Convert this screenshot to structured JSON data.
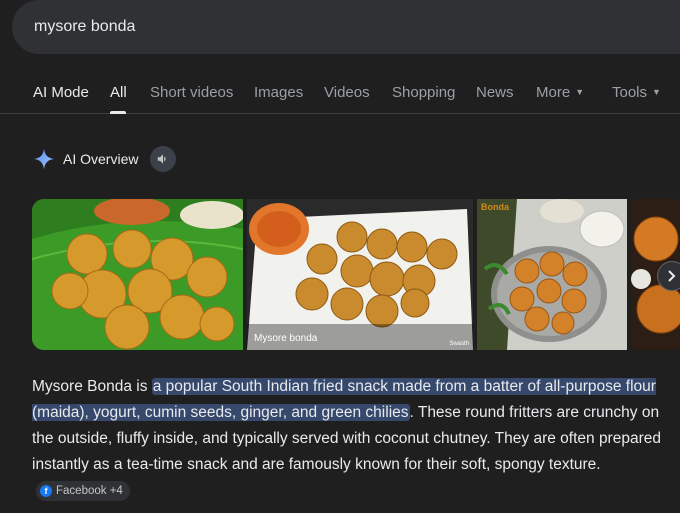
{
  "search": {
    "query": "mysore bonda"
  },
  "tabs": [
    {
      "label": "AI Mode"
    },
    {
      "label": "All"
    },
    {
      "label": "Short videos"
    },
    {
      "label": "Images"
    },
    {
      "label": "Videos"
    },
    {
      "label": "Shopping"
    },
    {
      "label": "News"
    },
    {
      "label": "More"
    },
    {
      "label": "Tools"
    }
  ],
  "active_tab": "All",
  "ai_overview": {
    "title": "AI Overview",
    "images": [
      {
        "icon": "food-photo"
      },
      {
        "caption": "Mysore bonda",
        "credit": "Swasth"
      },
      {
        "brand": "Bonda"
      },
      {
        "icon": "food-photo"
      }
    ],
    "paragraph": {
      "before": "Mysore Bonda is ",
      "highlight": "a popular South Indian fried snack made from a batter of all-purpose flour (maida), yogurt, cumin seeds, ginger, and green chilies",
      "after": ". These round fritters are crunchy on the outside, fluffy inside, and typically served with coconut chutney. They are often prepared instantly as a tea-time snack and are famously known for their soft, spongy texture."
    },
    "source_chip": {
      "label": "Facebook +4",
      "icon_letter": "f"
    }
  },
  "colors": {
    "background": "#1f1f1f",
    "highlight": "#36486b",
    "facebook": "#1877f2",
    "spark": "#8ab4f8"
  }
}
